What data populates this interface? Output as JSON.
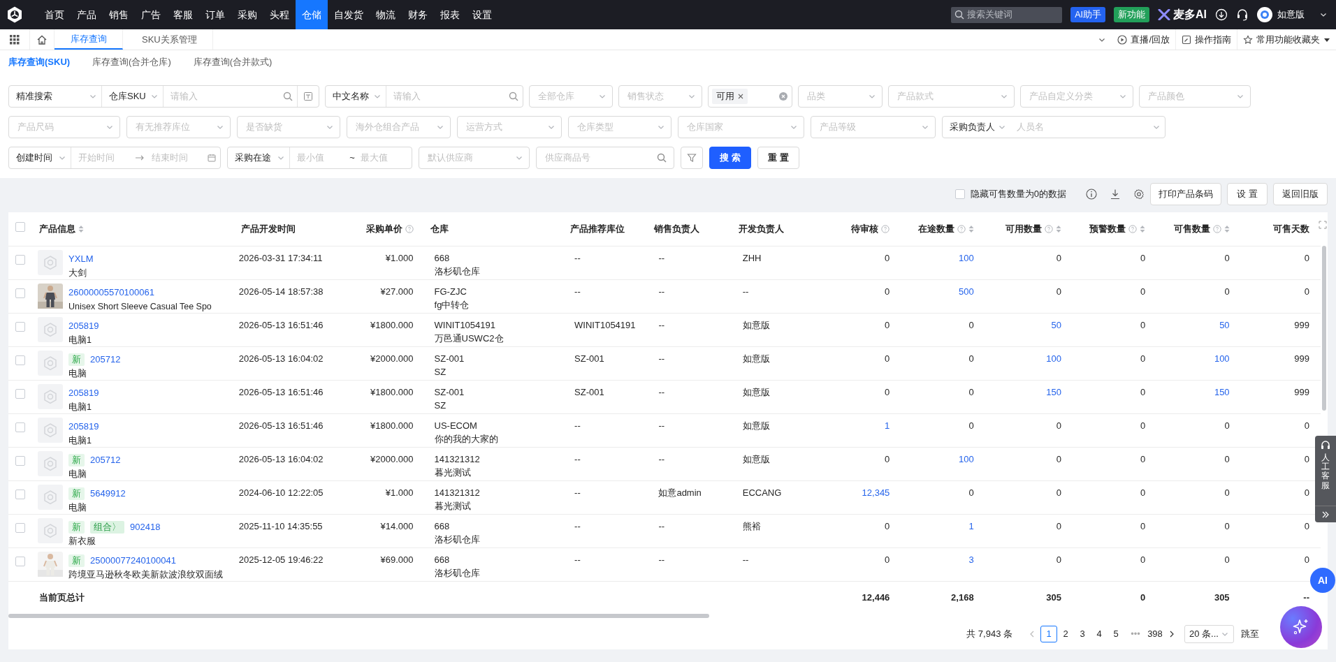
{
  "top_nav": {
    "items": [
      {
        "label": "首页",
        "selected": false
      },
      {
        "label": "产品",
        "selected": false
      },
      {
        "label": "销售",
        "selected": false
      },
      {
        "label": "广告",
        "selected": false
      },
      {
        "label": "客服",
        "selected": false
      },
      {
        "label": "订单",
        "selected": false
      },
      {
        "label": "采购",
        "selected": false
      },
      {
        "label": "头程",
        "selected": false
      },
      {
        "label": "仓储",
        "selected": true
      },
      {
        "label": "自发货",
        "selected": false
      },
      {
        "label": "物流",
        "selected": false
      },
      {
        "label": "财务",
        "selected": false
      },
      {
        "label": "报表",
        "selected": false
      },
      {
        "label": "设置",
        "selected": false
      }
    ],
    "search": {
      "placeholder": "搜索关键词"
    },
    "ai_button": "AI助手",
    "new_button": "新功能",
    "brand": "麦多AI",
    "user": "如意版"
  },
  "page_tabs": {
    "items": [
      {
        "label": "库存查询",
        "selected": true
      },
      {
        "label": "SKU关系管理",
        "selected": false
      }
    ],
    "links": [
      "直播/回放",
      "操作指南",
      "常用功能收藏夹"
    ]
  },
  "sub_tabs": [
    {
      "label": "库存查询(SKU)",
      "selected": true
    },
    {
      "label": "库存查询(合并仓库)",
      "selected": false
    },
    {
      "label": "库存查询(合并款式)",
      "selected": false
    }
  ],
  "filters": [
    [
      {
        "kind": "search_group",
        "mode": "精准搜索",
        "field": "仓库SKU",
        "placeholder": "请输入"
      },
      {
        "kind": "labeled_search",
        "label": "中文名称",
        "placeholder": "请输入"
      },
      {
        "kind": "select",
        "placeholder": "全部仓库"
      },
      {
        "kind": "select",
        "placeholder": "销售状态"
      },
      {
        "kind": "tags",
        "tags": [
          "可用"
        ]
      },
      {
        "kind": "select",
        "placeholder": "品类"
      },
      {
        "kind": "select",
        "placeholder": "产品款式"
      },
      {
        "kind": "select",
        "placeholder": "产品自定义分类"
      },
      {
        "kind": "select",
        "placeholder": "产品颜色"
      }
    ],
    [
      {
        "kind": "select",
        "placeholder": "产品尺码"
      },
      {
        "kind": "select",
        "placeholder": "有无推荐库位"
      },
      {
        "kind": "select",
        "placeholder": "是否缺货"
      },
      {
        "kind": "select",
        "placeholder": "海外仓组合产品"
      },
      {
        "kind": "select",
        "placeholder": "运营方式"
      },
      {
        "kind": "select",
        "placeholder": "仓库类型"
      },
      {
        "kind": "select",
        "placeholder": "仓库国家"
      },
      {
        "kind": "select",
        "placeholder": "产品等级"
      },
      {
        "kind": "labeled_select",
        "label": "采购负责人",
        "placeholder": "人员名"
      }
    ],
    [
      {
        "kind": "date_range",
        "label": "创建时间",
        "start": {
          "placeholder": "开始时间"
        },
        "end": {
          "placeholder": "结束时间"
        }
      },
      {
        "kind": "number_range",
        "label": "采购在途",
        "min": {
          "placeholder": "最小值"
        },
        "separator": "~",
        "max": {
          "placeholder": "最大值"
        }
      },
      {
        "kind": "select",
        "placeholder": "默认供应商"
      },
      {
        "kind": "search",
        "placeholder": "供应商品号"
      },
      {
        "kind": "icon_button"
      },
      {
        "kind": "primary",
        "label": "搜 索"
      },
      {
        "kind": "default",
        "label": "重 置"
      }
    ]
  ],
  "toolbar": {
    "hide_zero": {
      "label": "隐藏可售数量为0的数据",
      "checked": false
    },
    "buttons": [
      "打印产品条码",
      "设 置",
      "返回旧版"
    ]
  },
  "table": {
    "select_all": {
      "checked": false
    },
    "columns": [
      {
        "label": "产品信息",
        "help": false,
        "sortable": true
      },
      {
        "label": "产品开发时间",
        "help": false,
        "sortable": false
      },
      {
        "label": "采购单价",
        "help": true,
        "sortable": false
      },
      {
        "label": "仓库",
        "help": false,
        "sortable": false
      },
      {
        "label": "产品推荐库位",
        "help": false,
        "sortable": false
      },
      {
        "label": "销售负责人",
        "help": false,
        "sortable": false
      },
      {
        "label": "开发负责人",
        "help": false,
        "sortable": false
      },
      {
        "label": "待审核",
        "help": true,
        "sortable": false
      },
      {
        "label": "在途数量",
        "help": true,
        "sortable": true
      },
      {
        "label": "可用数量",
        "help": true,
        "sortable": true
      },
      {
        "label": "预警数量",
        "help": true,
        "sortable": true
      },
      {
        "label": "可售数量",
        "help": true,
        "sortable": true
      },
      {
        "label": "可售天数",
        "help": false,
        "sortable": false
      }
    ],
    "rows": [
      {
        "checked": false,
        "has_photo": false,
        "sku": "YXLM",
        "name": "大剑",
        "dev_time": "2026-03-31 17:34:11",
        "price": "¥1.000",
        "warehouse": "668",
        "warehouse_name": "洛杉矶仓库",
        "location": "--",
        "sales_owner": "--",
        "dev_owner": "ZHH",
        "qty": [
          {
            "text": "0",
            "link": false
          },
          {
            "text": "100",
            "link": true
          },
          {
            "text": "0",
            "link": false
          },
          {
            "text": "0",
            "link": false
          },
          {
            "text": "0",
            "link": false
          },
          {
            "text": "0",
            "link": false
          }
        ]
      },
      {
        "checked": false,
        "has_photo": true,
        "sku": "26000005570100061",
        "name": "Unisex Short Sleeve Casual Tee Spo",
        "dev_time": "2026-05-14 18:57:38",
        "price": "¥27.000",
        "warehouse": "FG-ZJC",
        "warehouse_name": "fg中转仓",
        "location": "--",
        "sales_owner": "--",
        "dev_owner": "--",
        "qty": [
          {
            "text": "0",
            "link": false
          },
          {
            "text": "500",
            "link": true
          },
          {
            "text": "0",
            "link": false
          },
          {
            "text": "0",
            "link": false
          },
          {
            "text": "0",
            "link": false
          },
          {
            "text": "0",
            "link": false
          }
        ]
      },
      {
        "checked": false,
        "has_photo": false,
        "sku": "205819",
        "name": "电脑1",
        "dev_time": "2026-05-13 16:51:46",
        "price": "¥1800.000",
        "warehouse": "WINIT1054191",
        "warehouse_name": "万邑通USWC2仓",
        "location": "WINIT1054191",
        "sales_owner": "--",
        "dev_owner": "如意版",
        "qty": [
          {
            "text": "0",
            "link": false
          },
          {
            "text": "0",
            "link": false
          },
          {
            "text": "50",
            "link": true
          },
          {
            "text": "0",
            "link": false
          },
          {
            "text": "50",
            "link": true
          },
          {
            "text": "999",
            "link": false
          }
        ]
      },
      {
        "checked": false,
        "has_photo": false,
        "tags": [
          {
            "label": "新",
            "kind": "new"
          }
        ],
        "sku": "205712",
        "name": "电脑",
        "dev_time": "2026-05-13 16:04:02",
        "price": "¥2000.000",
        "warehouse": "SZ-001",
        "warehouse_name": "SZ",
        "location": "SZ-001",
        "sales_owner": "--",
        "dev_owner": "如意版",
        "qty": [
          {
            "text": "0",
            "link": false
          },
          {
            "text": "0",
            "link": false
          },
          {
            "text": "100",
            "link": true
          },
          {
            "text": "0",
            "link": false
          },
          {
            "text": "100",
            "link": true
          },
          {
            "text": "999",
            "link": false
          }
        ]
      },
      {
        "checked": false,
        "has_photo": false,
        "sku": "205819",
        "name": "电脑1",
        "dev_time": "2026-05-13 16:51:46",
        "price": "¥1800.000",
        "warehouse": "SZ-001",
        "warehouse_name": "SZ",
        "location": "SZ-001",
        "sales_owner": "--",
        "dev_owner": "如意版",
        "qty": [
          {
            "text": "0",
            "link": false
          },
          {
            "text": "0",
            "link": false
          },
          {
            "text": "150",
            "link": true
          },
          {
            "text": "0",
            "link": false
          },
          {
            "text": "150",
            "link": true
          },
          {
            "text": "999",
            "link": false
          }
        ]
      },
      {
        "checked": false,
        "has_photo": false,
        "sku": "205819",
        "name": "电脑1",
        "dev_time": "2026-05-13 16:51:46",
        "price": "¥1800.000",
        "warehouse": "US-ECOM",
        "warehouse_name": "你的我的大家的",
        "location": "--",
        "sales_owner": "--",
        "dev_owner": "如意版",
        "qty": [
          {
            "text": "1",
            "link": true
          },
          {
            "text": "0",
            "link": false
          },
          {
            "text": "0",
            "link": false
          },
          {
            "text": "0",
            "link": false
          },
          {
            "text": "0",
            "link": false
          },
          {
            "text": "0",
            "link": false
          }
        ]
      },
      {
        "checked": false,
        "has_photo": false,
        "tags": [
          {
            "label": "新",
            "kind": "new"
          }
        ],
        "sku": "205712",
        "name": "电脑",
        "dev_time": "2026-05-13 16:04:02",
        "price": "¥2000.000",
        "warehouse": "141321312",
        "warehouse_name": "暮光测试",
        "location": "--",
        "sales_owner": "--",
        "dev_owner": "如意版",
        "qty": [
          {
            "text": "0",
            "link": false
          },
          {
            "text": "100",
            "link": true
          },
          {
            "text": "0",
            "link": false
          },
          {
            "text": "0",
            "link": false
          },
          {
            "text": "0",
            "link": false
          },
          {
            "text": "0",
            "link": false
          }
        ]
      },
      {
        "checked": false,
        "has_photo": false,
        "tags": [
          {
            "label": "新",
            "kind": "new"
          }
        ],
        "sku": "5649912",
        "name": "电脑",
        "dev_time": "2024-06-10 12:22:05",
        "price": "¥1.000",
        "warehouse": "141321312",
        "warehouse_name": "暮光测试",
        "location": "--",
        "sales_owner": "如意admin",
        "dev_owner": "ECCANG",
        "qty": [
          {
            "text": "12,345",
            "link": true
          },
          {
            "text": "0",
            "link": false
          },
          {
            "text": "0",
            "link": false
          },
          {
            "text": "0",
            "link": false
          },
          {
            "text": "0",
            "link": false
          },
          {
            "text": "0",
            "link": false
          }
        ]
      },
      {
        "checked": false,
        "has_photo": false,
        "tags": [
          {
            "label": "新",
            "kind": "new"
          },
          {
            "label": "组合〉",
            "kind": "bundle"
          }
        ],
        "sku": "902418",
        "name": "新衣服",
        "dev_time": "2025-11-10 14:35:55",
        "price": "¥14.000",
        "warehouse": "668",
        "warehouse_name": "洛杉矶仓库",
        "location": "--",
        "sales_owner": "--",
        "dev_owner": "熊裕",
        "qty": [
          {
            "text": "0",
            "link": false
          },
          {
            "text": "1",
            "link": true
          },
          {
            "text": "0",
            "link": false
          },
          {
            "text": "0",
            "link": false
          },
          {
            "text": "0",
            "link": false
          },
          {
            "text": "0",
            "link": false
          }
        ]
      },
      {
        "checked": false,
        "has_photo": true,
        "tags": [
          {
            "label": "新",
            "kind": "new"
          }
        ],
        "sku": "25000077240100041",
        "name": "跨境亚马逊秋冬欧美新款波浪纹双面绒",
        "dev_time": "2025-12-05 19:46:22",
        "price": "¥69.000",
        "warehouse": "668",
        "warehouse_name": "洛杉矶仓库",
        "location": "--",
        "sales_owner": "--",
        "dev_owner": "--",
        "qty": [
          {
            "text": "0",
            "link": false
          },
          {
            "text": "3",
            "link": true
          },
          {
            "text": "0",
            "link": false
          },
          {
            "text": "0",
            "link": false
          },
          {
            "text": "0",
            "link": false
          },
          {
            "text": "0",
            "link": false
          }
        ]
      }
    ],
    "summary": {
      "label": "当前页总计",
      "values": [
        "12,446",
        "2,168",
        "305",
        "0",
        "305",
        "--"
      ]
    }
  },
  "pagination": {
    "total": "共 7,943 条",
    "pages": [
      {
        "kind": "page",
        "label": "1",
        "selected": true
      },
      {
        "kind": "page",
        "label": "2",
        "selected": false
      },
      {
        "kind": "page",
        "label": "3",
        "selected": false
      },
      {
        "kind": "page",
        "label": "4",
        "selected": false
      },
      {
        "kind": "page",
        "label": "5",
        "selected": false
      },
      {
        "kind": "ellipsis",
        "label": "•••"
      },
      {
        "kind": "page",
        "label": "398",
        "selected": false
      }
    ],
    "page_size": "20 条...",
    "jump": "跳至"
  },
  "side": {
    "support": "人工客服",
    "ai_badge": "AI"
  }
}
